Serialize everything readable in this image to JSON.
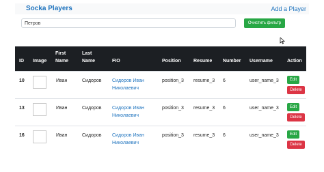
{
  "navbar": {
    "brand": "Socka Players",
    "add_link": "Add a Player"
  },
  "filter": {
    "value": "Петров",
    "clear_button": "Очистить фильтр"
  },
  "table": {
    "headers": {
      "id": "ID",
      "image": "Image",
      "first_name": [
        "First",
        "Name"
      ],
      "last_name": [
        "Last",
        "Name"
      ],
      "fio": "FIO",
      "position": "Position",
      "resume": "Resume",
      "number": "Number",
      "username": "Username",
      "action": "Action"
    },
    "rows": [
      {
        "id": "10",
        "first_name": "Иван",
        "last_name": "Сидоров",
        "fio": [
          "Сидоров Иван",
          "Николаевич"
        ],
        "position": "position_3",
        "resume": "resume_3",
        "number": "6",
        "username": "user_name_3",
        "edit": "Edit",
        "delete": "Delete"
      },
      {
        "id": "13",
        "first_name": "Иван",
        "last_name": "Сидоров",
        "fio": [
          "Сидоров Иван",
          "Николаевич"
        ],
        "position": "position_3",
        "resume": "resume_3",
        "number": "6",
        "username": "user_name_3",
        "edit": "Edit",
        "delete": "Delete"
      },
      {
        "id": "16",
        "first_name": "Иван",
        "last_name": "Сидоров",
        "fio": [
          "Сидоров Иван",
          "Николаевич"
        ],
        "position": "position_3",
        "resume": "resume_3",
        "number": "6",
        "username": "user_name_3",
        "edit": "Edit",
        "delete": "Delete"
      }
    ]
  },
  "colors": {
    "brand": "#1e73be",
    "header_bg": "#1c1f23",
    "success": "#28a745",
    "danger": "#dc3545"
  },
  "icons": {
    "cursor": "mouse-pointer-icon"
  }
}
